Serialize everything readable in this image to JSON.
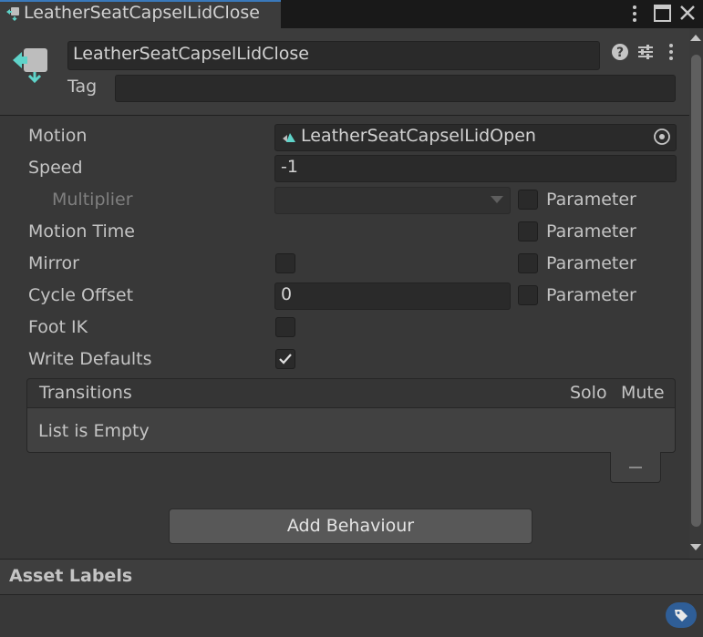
{
  "tab": {
    "title": "LeatherSeatCapselLidClose"
  },
  "header": {
    "name_value": "LeatherSeatCapselLidClose",
    "tag_label": "Tag",
    "tag_value": ""
  },
  "properties": {
    "motion_label": "Motion",
    "motion_value": "LeatherSeatCapselLidOpen",
    "speed_label": "Speed",
    "speed_value": "-1",
    "multiplier_label": "Multiplier",
    "motion_time_label": "Motion Time",
    "mirror_label": "Mirror",
    "cycle_offset_label": "Cycle Offset",
    "cycle_offset_value": "0",
    "foot_ik_label": "Foot IK",
    "write_defaults_label": "Write Defaults",
    "parameter_label": "Parameter",
    "mirror_checked": false,
    "foot_ik_checked": false,
    "write_defaults_checked": true
  },
  "transitions": {
    "header": "Transitions",
    "solo": "Solo",
    "mute": "Mute",
    "empty_text": "List is Empty"
  },
  "add_behaviour_label": "Add Behaviour",
  "asset_labels": {
    "title": "Asset Labels"
  },
  "icons": {
    "tab": "animator-state-icon",
    "asset": "animator-state-icon",
    "help": "help-icon",
    "presets": "presets-icon",
    "more": "more-vertical-icon",
    "target": "object-picker-icon",
    "tag": "tag-icon"
  },
  "colors": {
    "accent": "#3a79bb",
    "tag_button": "#2f5e97"
  }
}
